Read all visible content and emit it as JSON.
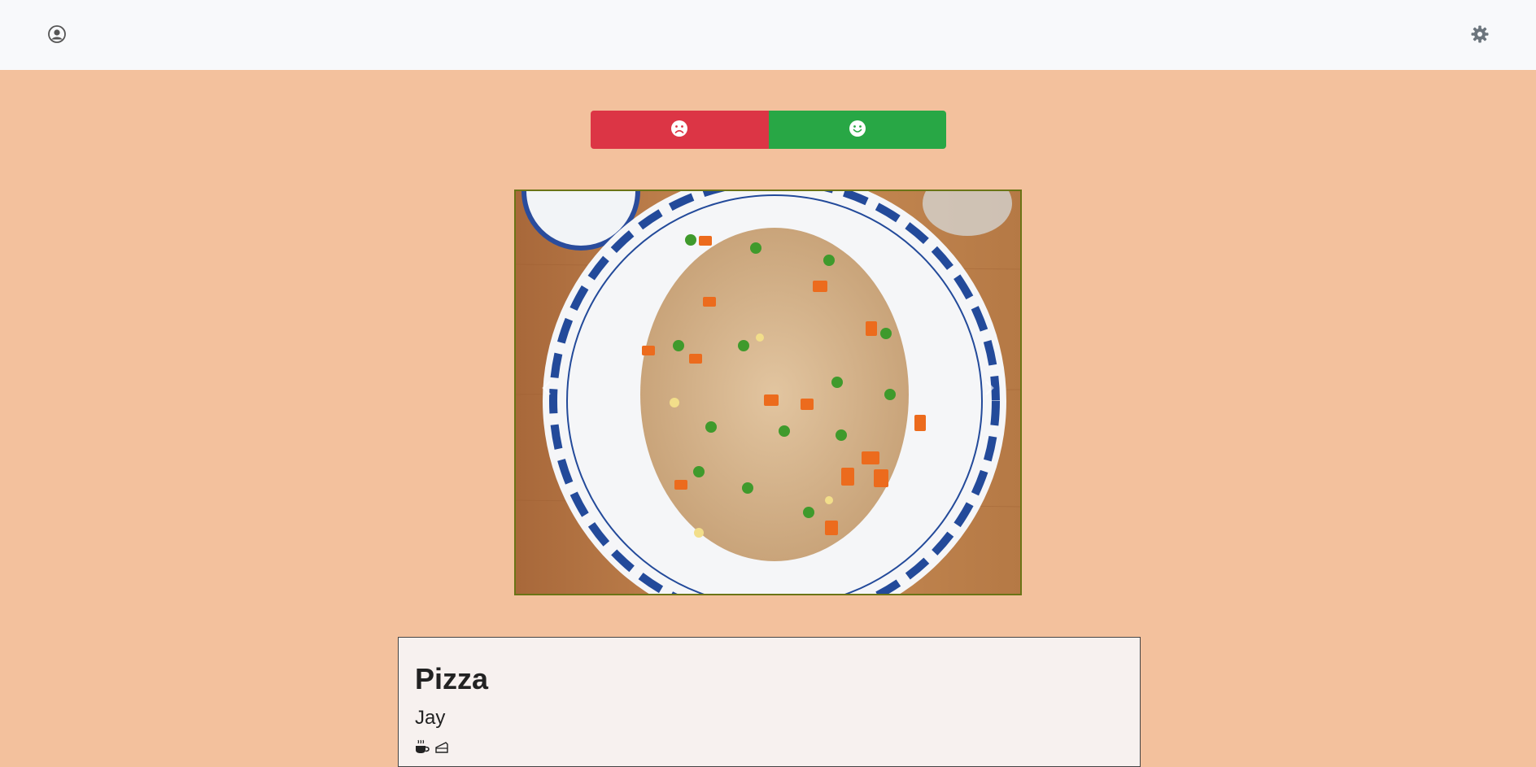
{
  "navbar": {
    "left_icon": "user-circle-icon",
    "right_icon": "gear-icon"
  },
  "vote": {
    "dislike_icon": "frown-icon",
    "like_icon": "smile-icon",
    "dislike_color": "#dc3545",
    "like_color": "#28a745"
  },
  "carousel": {
    "image_subject": "fried-rice-photo",
    "prev_icon": "chevron-left-icon",
    "next_icon": "chevron-right-icon",
    "border_color": "#6b7416"
  },
  "card": {
    "title": "Pizza",
    "author": "Jay",
    "tag_icons": [
      "coffee-cup-icon",
      "cake-slice-icon"
    ]
  },
  "colors": {
    "page_background": "#f3c19d",
    "navbar_background": "#f8f9fb",
    "card_background": "#f7f1ef"
  }
}
